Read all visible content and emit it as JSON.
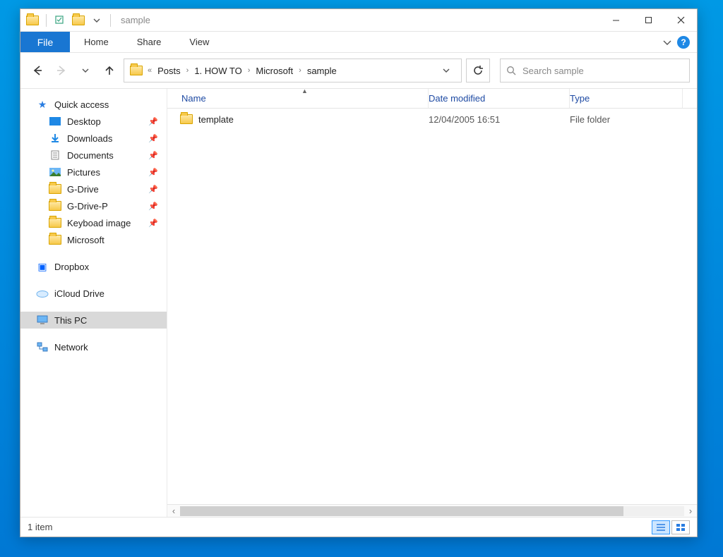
{
  "title": "sample",
  "ribbon": {
    "file": "File",
    "tabs": [
      "Home",
      "Share",
      "View"
    ]
  },
  "nav": {
    "back_enabled": true,
    "forward_enabled": false
  },
  "breadcrumbs": [
    "Posts",
    "1. HOW TO",
    "Microsoft",
    "sample"
  ],
  "search_placeholder": "Search sample",
  "nav_pane": {
    "quick_access": {
      "label": "Quick access",
      "items": [
        {
          "label": "Desktop",
          "pinned": true,
          "icon": "desktop"
        },
        {
          "label": "Downloads",
          "pinned": true,
          "icon": "downloads"
        },
        {
          "label": "Documents",
          "pinned": true,
          "icon": "documents"
        },
        {
          "label": "Pictures",
          "pinned": true,
          "icon": "pictures"
        },
        {
          "label": "G-Drive",
          "pinned": true,
          "icon": "folder"
        },
        {
          "label": "G-Drive-P",
          "pinned": true,
          "icon": "folder"
        },
        {
          "label": "Keyboad image",
          "pinned": true,
          "icon": "folder"
        },
        {
          "label": "Microsoft",
          "pinned": false,
          "icon": "folder"
        }
      ]
    },
    "roots": [
      {
        "label": "Dropbox",
        "icon": "dropbox"
      },
      {
        "label": "iCloud Drive",
        "icon": "icloud"
      },
      {
        "label": "This PC",
        "icon": "thispc",
        "selected": true
      },
      {
        "label": "Network",
        "icon": "network"
      }
    ]
  },
  "columns": {
    "name": "Name",
    "date": "Date modified",
    "type": "Type"
  },
  "rows": [
    {
      "name": "template",
      "date": "12/04/2005 16:51",
      "type": "File folder"
    }
  ],
  "status": "1 item"
}
